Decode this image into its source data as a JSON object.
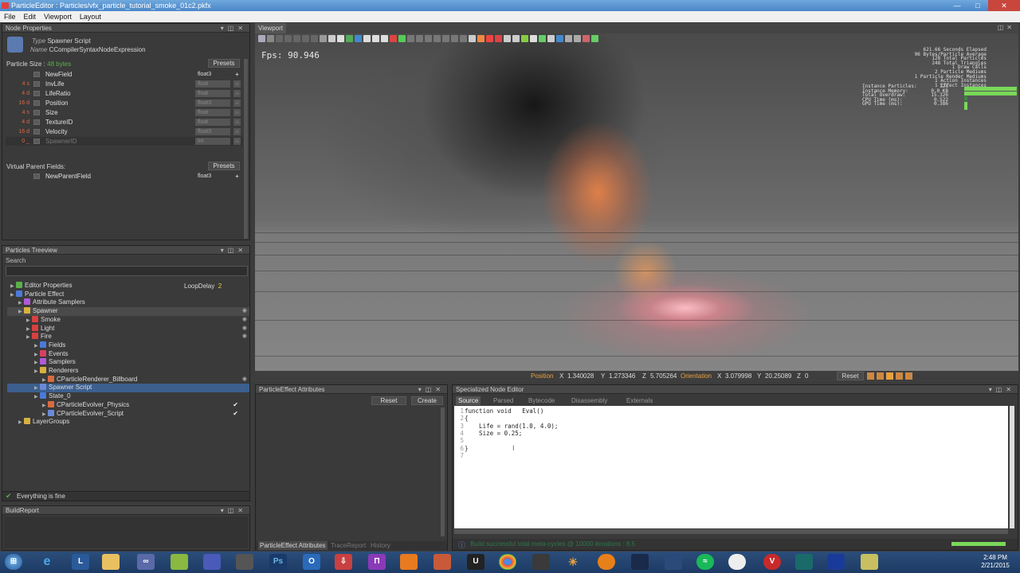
{
  "window": {
    "title": "ParticleEditor : Particles/vfx_particle_tutorial_smoke_01c2.pkfx"
  },
  "menu": [
    "File",
    "Edit",
    "Viewport",
    "Layout"
  ],
  "node_properties": {
    "title": "Node Properties",
    "type_label": "Type",
    "type_value": "Spawner Script",
    "name_label": "Name",
    "name_value": "CCompilerSyntaxNodeExpression",
    "particle_size_label": "Particle Size :",
    "particle_size_value": "48 bytes",
    "presets_label": "Presets",
    "fields": [
      {
        "size": "",
        "name": "NewField",
        "type": "float3",
        "active": true
      },
      {
        "size": "4 s",
        "name": "InvLife",
        "type": "float",
        "active": false
      },
      {
        "size": "4 d",
        "name": "LifeRatio",
        "type": "float",
        "active": false
      },
      {
        "size": "16 d",
        "name": "Position",
        "type": "float3",
        "active": false
      },
      {
        "size": "4 s",
        "name": "Size",
        "type": "float",
        "active": false
      },
      {
        "size": "4 d",
        "name": "TextureID",
        "type": "float",
        "active": false
      },
      {
        "size": "16 d",
        "name": "Velocity",
        "type": "float3",
        "active": false
      },
      {
        "size": "0 _",
        "name": "SpawnerID",
        "type": "int",
        "active": false
      }
    ],
    "virtual_parent_label": "Virtual Parent Fields:",
    "virtual_presets_label": "Presets",
    "virtual_field": {
      "name": "NewParentField",
      "type": "float3"
    }
  },
  "treeview": {
    "title": "Particles Treeview",
    "search_label": "Search",
    "loopdelay_label": "LoopDelay",
    "loopdelay_value": "2",
    "items": [
      {
        "label": "Editor Properties",
        "indent": 0,
        "color": "#5ab04a"
      },
      {
        "label": "Particle Effect",
        "indent": 0,
        "color": "#4a7ad8"
      },
      {
        "label": "Attribute Samplers",
        "indent": 1,
        "color": "#b05ad8"
      },
      {
        "label": "Spawner",
        "indent": 1,
        "color": "#d8b040"
      },
      {
        "label": "Smoke",
        "indent": 2,
        "color": "#d84040"
      },
      {
        "label": "Light",
        "indent": 2,
        "color": "#d84040"
      },
      {
        "label": "Fire",
        "indent": 2,
        "color": "#d84040"
      },
      {
        "label": "Fields",
        "indent": 3,
        "color": "#4a7ad8"
      },
      {
        "label": "Events",
        "indent": 3,
        "color": "#d84060"
      },
      {
        "label": "Samplers",
        "indent": 3,
        "color": "#b05ad8"
      },
      {
        "label": "Renderers",
        "indent": 3,
        "color": "#d8b040"
      },
      {
        "label": "CParticleRenderer_Billboard",
        "indent": 4,
        "color": "#d86a40"
      },
      {
        "label": "Spawner Script",
        "indent": 3,
        "color": "#6a8ad8"
      },
      {
        "label": "State_0",
        "indent": 3,
        "color": "#4a7ad8"
      },
      {
        "label": "CParticleEvolver_Physics",
        "indent": 4,
        "color": "#d86a40"
      },
      {
        "label": "CParticleEvolver_Script",
        "indent": 4,
        "color": "#6a8ad8"
      },
      {
        "label": "LayerGroups",
        "indent": 1,
        "color": "#d8b040"
      }
    ],
    "status": "Everything is fine"
  },
  "build_report": {
    "title": "BuildReport"
  },
  "viewport": {
    "title": "Viewport",
    "fps_label": "Fps:",
    "fps_value": "90.946",
    "stats_lines": [
      "621.66 Seconds Elapsed",
      "96 Bytes/Particle Average",
      "128 Total Particles",
      "248 Total Triangles",
      "1 Draw Calls",
      "2 Particle Mediums",
      "1 Particle Render Mediums",
      "1 Action Instances",
      "1 Effect Instances"
    ],
    "stats2_lines": [
      "Instance Particles:",
      "Instance Memory:",
      "Total Overdraw:",
      "CPU Time (ms):",
      "GPU Time (ms):"
    ],
    "stats2_values": [
      "128",
      "0.0 KB",
      "15.326",
      "0.522",
      "0.386"
    ],
    "position_label": "Position",
    "pos_x_label": "X",
    "pos_x": "1.340028",
    "pos_y_label": "Y",
    "pos_y": "1.273346",
    "pos_z_label": "Z",
    "pos_z": "5.705264",
    "orientation_label": "Orientation",
    "or_x_label": "X",
    "or_x": "3.079998",
    "or_y_label": "Y",
    "or_y": "20.25089",
    "or_z_label": "Z",
    "or_z": "0",
    "reset_label": "Reset"
  },
  "attributes": {
    "title": "ParticleEffect Attributes",
    "reset_label": "Reset",
    "create_label": "Create",
    "tabs": [
      "ParticleEffect Attributes",
      "TraceReport",
      "History"
    ]
  },
  "node_editor": {
    "title": "Specialized Node Editor",
    "tabs": [
      "Source",
      "Parsed",
      "Bytecode",
      "Disassembly",
      "Externals"
    ],
    "lines": [
      {
        "n": "1",
        "text": "function void   Eval()"
      },
      {
        "n": "2",
        "text": "{"
      },
      {
        "n": "3",
        "text": "    Life = rand(1.0, 4.0);"
      },
      {
        "n": "4",
        "text": "    Size = 0.25;"
      },
      {
        "n": "5",
        "text": ""
      },
      {
        "n": "6",
        "text": "}"
      },
      {
        "n": "7",
        "text": ""
      }
    ],
    "status": "Build successful total meta-cycles @ 10000 iterations : 8.5"
  },
  "taskbar": {
    "time": "2:48 PM",
    "date": "2/21/2015"
  },
  "colors": {
    "accent_orange": "#e8a040",
    "selection": "#3c5f8e",
    "panel_bg": "#3a3a3a",
    "ok_green": "#5ab04a"
  }
}
